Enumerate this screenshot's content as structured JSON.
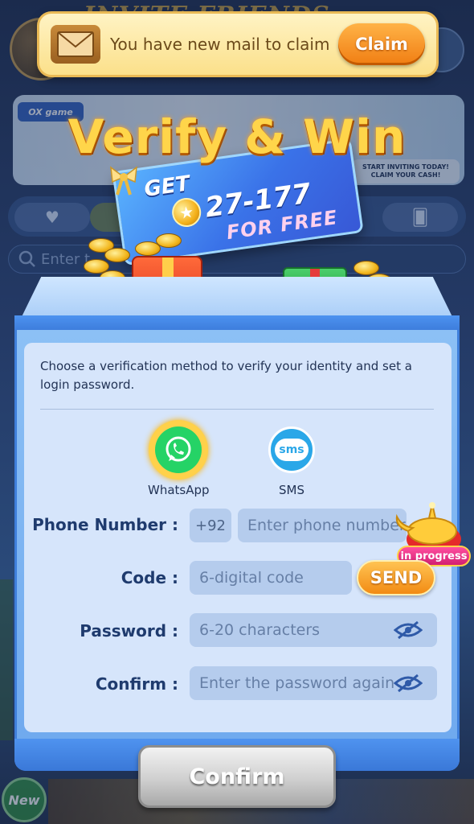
{
  "mail": {
    "message": "You have new mail to claim",
    "claim_label": "Claim"
  },
  "promo": {
    "title": "Verify & Win",
    "get_label": "GET",
    "reward_range": "27-177",
    "free_label": "FOR FREE"
  },
  "background": {
    "banner_title": "INVITE FRIENDS",
    "banner_right_line1": "START INVITING TODAY!",
    "banner_right_line2": "CLAIM YOUR CASH!",
    "search_placeholder": "Enter t",
    "new_badge": "New"
  },
  "form": {
    "instructions": "Choose a verification method to verify your identity and set a login password.",
    "methods": [
      {
        "label": "WhatsApp",
        "icon": "whatsapp-icon",
        "selected": true
      },
      {
        "label": "SMS",
        "icon": "sms-icon",
        "selected": false
      }
    ],
    "sms_icon_text": "sms",
    "phone": {
      "label": "Phone Number :",
      "prefix": "+92",
      "placeholder": "Enter phone number"
    },
    "code": {
      "label": "Code :",
      "placeholder": "6-digital code",
      "send_label": "SEND"
    },
    "password": {
      "label": "Password :",
      "placeholder": "6-20 characters"
    },
    "confirm": {
      "label": "Confirm :",
      "placeholder": "Enter the password again"
    },
    "confirm_button": "Confirm"
  },
  "status": {
    "in_progress": "in progress"
  },
  "colors": {
    "accent_orange": "#f28b14",
    "modal_blue": "#3f7fdb",
    "label_navy": "#1f3b6e",
    "whatsapp_green": "#25d366",
    "sms_blue": "#2aa7e8"
  }
}
